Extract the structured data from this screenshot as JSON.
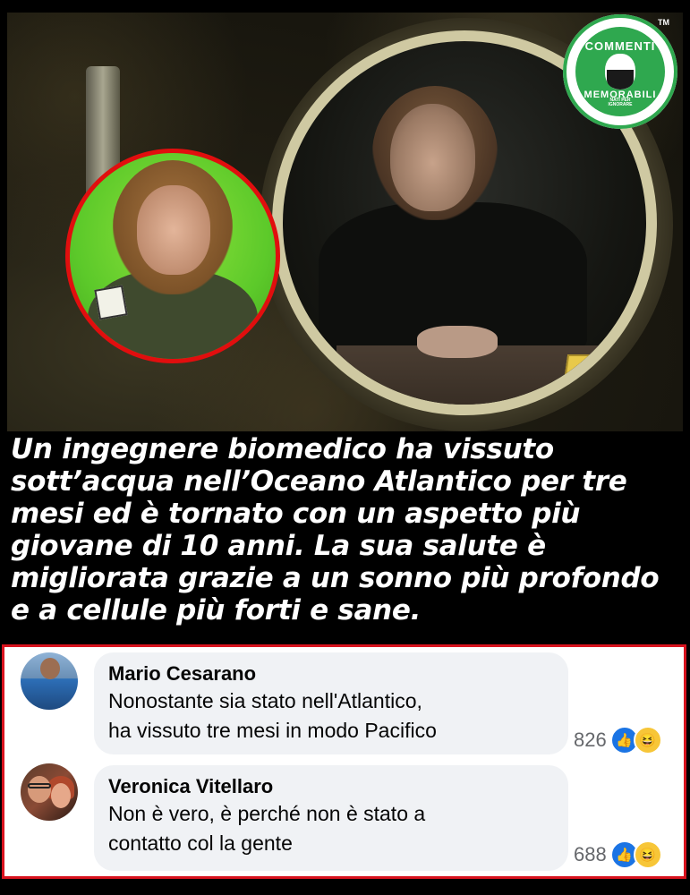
{
  "logo": {
    "top_text": "COMMENTI",
    "bottom_text": "MEMORABILI",
    "tagline": "NATI PER IGNORARE",
    "trademark": "TM",
    "accent_color": "#2fa84f"
  },
  "headline": "Un ingegnere biomedico ha vissuto sott’acqua nell’Oceano Atlantico per tre mesi ed è tornato con un aspetto più giovane di 10 anni. La sua salute è migliorata grazie a un sonno più profondo e a cellule più forti e sane.",
  "comments": [
    {
      "author": "Mario Cesarano",
      "line1": "Nonostante sia stato nell'Atlantico,",
      "line2": "ha vissuto tre mesi in modo Pacifico",
      "reactions_count": "826",
      "reaction_icons": [
        "like-icon",
        "haha-icon"
      ]
    },
    {
      "author": "Veronica Vitellaro",
      "line1": "Non è vero, è perché non è stato a",
      "line2": "contatto col la gente",
      "reactions_count": "688",
      "reaction_icons": [
        "like-icon",
        "haha-icon"
      ]
    }
  ],
  "colors": {
    "inset_border": "#e10e0e",
    "comments_border": "#d8131e",
    "like": "#1b74e4",
    "haha": "#f7c638"
  }
}
